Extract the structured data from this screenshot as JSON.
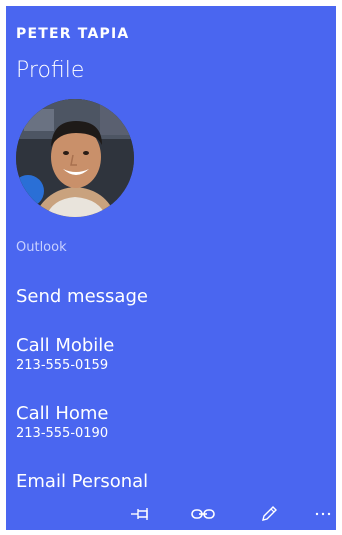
{
  "contact": {
    "name": "PETER TAPIA",
    "page_title": "Profile",
    "account": "Outlook"
  },
  "actions": [
    {
      "label": "Send message",
      "detail": ""
    },
    {
      "label": "Call Mobile",
      "detail": "213-555-0159"
    },
    {
      "label": "Call Home",
      "detail": "213-555-0190"
    },
    {
      "label": "Email Personal",
      "detail": ""
    }
  ],
  "app_bar": {
    "icons": [
      "pin-icon",
      "link-icon",
      "edit-icon",
      "more-icon"
    ]
  },
  "colors": {
    "background": "#4a66f0",
    "text": "#ffffff",
    "secondary_text": "#c8d0ff"
  }
}
